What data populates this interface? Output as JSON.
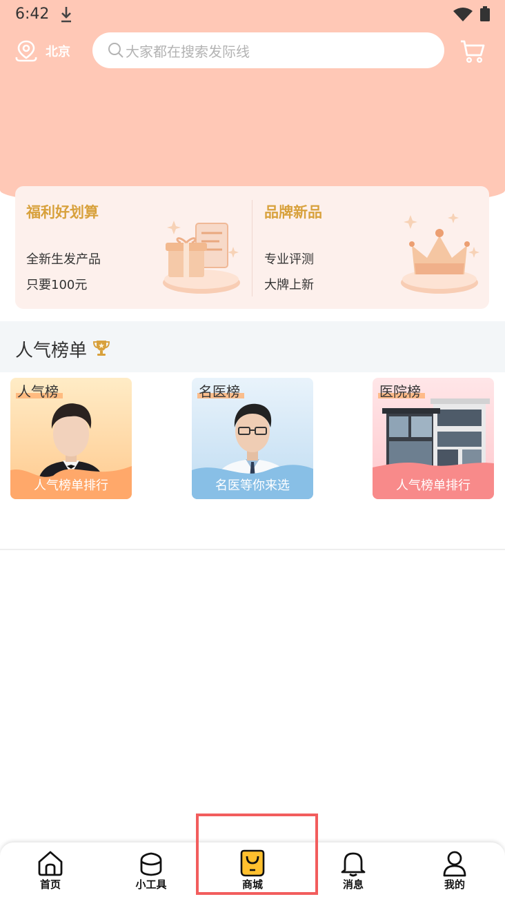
{
  "status_bar": {
    "time": "6:42"
  },
  "header": {
    "location": "北京",
    "search_placeholder": "大家都在搜索发际线"
  },
  "promos": [
    {
      "title": "福利好划算",
      "line1": "全新生发产品",
      "line2": "只要100元",
      "icon": "gift-icon"
    },
    {
      "title": "品牌新品",
      "line1": "专业评测",
      "line2": "大牌上新",
      "icon": "crown-icon"
    }
  ],
  "section": {
    "title": "人气榜单",
    "icon": "trophy-icon"
  },
  "rank_cards": [
    {
      "tag": "人气榜",
      "caption": "人气榜单排行"
    },
    {
      "tag": "名医榜",
      "caption": "名医等你来选"
    },
    {
      "tag": "医院榜",
      "caption": "人气榜单排行"
    }
  ],
  "tabbar": {
    "items": [
      {
        "label": "首页",
        "icon": "home-icon"
      },
      {
        "label": "小工具",
        "icon": "tools-icon"
      },
      {
        "label": "商城",
        "icon": "shop-bag-icon",
        "active": true
      },
      {
        "label": "消息",
        "icon": "bell-icon"
      },
      {
        "label": "我的",
        "icon": "user-icon"
      }
    ]
  },
  "colors": {
    "hero": "#ffc8b6",
    "accent_gold": "#d8a13c",
    "active_tab": "#ffc02e",
    "highlight_box": "#f25d5d"
  }
}
